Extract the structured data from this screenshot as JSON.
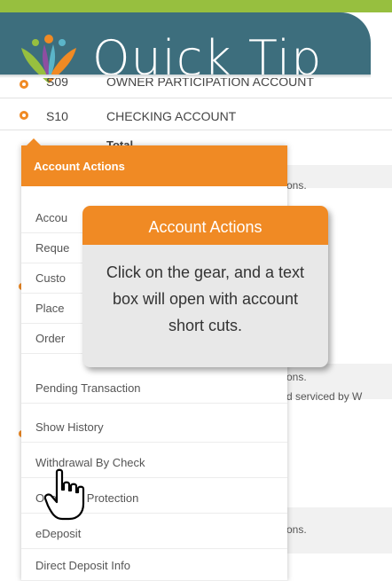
{
  "banner": {
    "title": "Quick Tip",
    "logo_icon": "leaf-people-logo-icon"
  },
  "accounts": [
    {
      "number": "S09",
      "name": "OWNER PARTICIPATION ACCOUNT"
    },
    {
      "number": "S10",
      "name": "CHECKING ACCOUNT"
    }
  ],
  "total_label": "Total",
  "background_snippets": {
    "s1": "ons.",
    "s2": "ons.",
    "s3": "d serviced by W",
    "s4": "ons."
  },
  "menu": {
    "header": "Account Actions",
    "items": [
      "Accou",
      "Reque",
      "Custo",
      "Place",
      "Order",
      "Pending Transaction",
      "Show History",
      "Withdrawal By Check",
      "Overdraft Protection",
      "eDeposit",
      "Direct Deposit Info"
    ]
  },
  "tooltip": {
    "header": "Account Actions",
    "body": "Click on the gear, and a text box will open with account short cuts."
  },
  "colors": {
    "accent_orange": "#f08a24",
    "banner_teal": "#3d6e7d",
    "banner_green": "#97bf3f"
  },
  "cursor_icon": "hand-pointer-icon"
}
